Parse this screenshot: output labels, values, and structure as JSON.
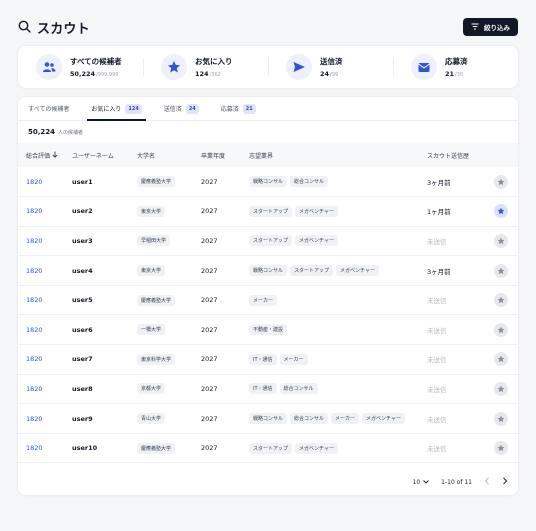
{
  "header": {
    "title": "スカウト",
    "filter_label": "絞り込み"
  },
  "stats": [
    {
      "label": "すべての候補者",
      "value": "50,224",
      "total": "/999,999",
      "icon": "users-icon"
    },
    {
      "label": "お気に入り",
      "value": "124",
      "total": "/362",
      "icon": "star-icon"
    },
    {
      "label": "送信済",
      "value": "24",
      "total": "/99",
      "icon": "send-icon"
    },
    {
      "label": "応募済",
      "value": "21",
      "total": "/30",
      "icon": "inbox-icon"
    }
  ],
  "tabs": [
    {
      "label": "すべての候補者",
      "badge": ""
    },
    {
      "label": "お気に入り",
      "badge": "124"
    },
    {
      "label": "送信済",
      "badge": "24"
    },
    {
      "label": "応募済",
      "badge": "21"
    }
  ],
  "result": {
    "count": "50,224",
    "suffix": "人の候補者"
  },
  "columns": [
    "総合評価",
    "ユーザーネーム",
    "大学名",
    "卒業年度",
    "志望業界",
    "スカウト送信歴"
  ],
  "rows": [
    {
      "score": "1820",
      "user": "user1",
      "uni": "慶應義塾大学",
      "year": "2027",
      "industries": [
        "戦略コンサル",
        "総合コンサル"
      ],
      "history": "3ヶ月前",
      "fav": false
    },
    {
      "score": "1820",
      "user": "user2",
      "uni": "東京大学",
      "year": "2027",
      "industries": [
        "スタートアップ",
        "メガベンチャー"
      ],
      "history": "1ヶ月前",
      "fav": true
    },
    {
      "score": "1820",
      "user": "user3",
      "uni": "早稲田大学",
      "year": "2027",
      "industries": [
        "スタートアップ",
        "メガベンチャー"
      ],
      "history": "未送信",
      "fav": false
    },
    {
      "score": "1820",
      "user": "user4",
      "uni": "東京大学",
      "year": "2027",
      "industries": [
        "戦略コンサル",
        "スタートアップ",
        "メガベンチャー"
      ],
      "history": "3ヶ月前",
      "fav": false
    },
    {
      "score": "1820",
      "user": "user5",
      "uni": "慶應義塾大学",
      "year": "2027",
      "industries": [
        "メーカー"
      ],
      "history": "未送信",
      "fav": false
    },
    {
      "score": "1820",
      "user": "user6",
      "uni": "一橋大学",
      "year": "2027",
      "industries": [
        "不動産・建設"
      ],
      "history": "未送信",
      "fav": false
    },
    {
      "score": "1820",
      "user": "user7",
      "uni": "東京科学大学",
      "year": "2027",
      "industries": [
        "IT・通信",
        "メーカー"
      ],
      "history": "未送信",
      "fav": false
    },
    {
      "score": "1820",
      "user": "user8",
      "uni": "京都大学",
      "year": "2027",
      "industries": [
        "IT・通信",
        "総合コンサル"
      ],
      "history": "未送信",
      "fav": false
    },
    {
      "score": "1820",
      "user": "user9",
      "uni": "青山大学",
      "year": "2027",
      "industries": [
        "戦略コンサル",
        "総合コンサル",
        "メーカー",
        "メガベンチャー"
      ],
      "history": "未送信",
      "fav": false
    },
    {
      "score": "1820",
      "user": "user10",
      "uni": "慶應義塾大学",
      "year": "2027",
      "industries": [
        "スタートアップ",
        "メガベンチャー"
      ],
      "history": "未送信",
      "fav": false
    }
  ],
  "pager": {
    "per_page": "10",
    "range": "1-10 of 11"
  },
  "colors": {
    "accent": "#2f55d4",
    "dark": "#111827",
    "icon_bg": "#eef0fb"
  }
}
